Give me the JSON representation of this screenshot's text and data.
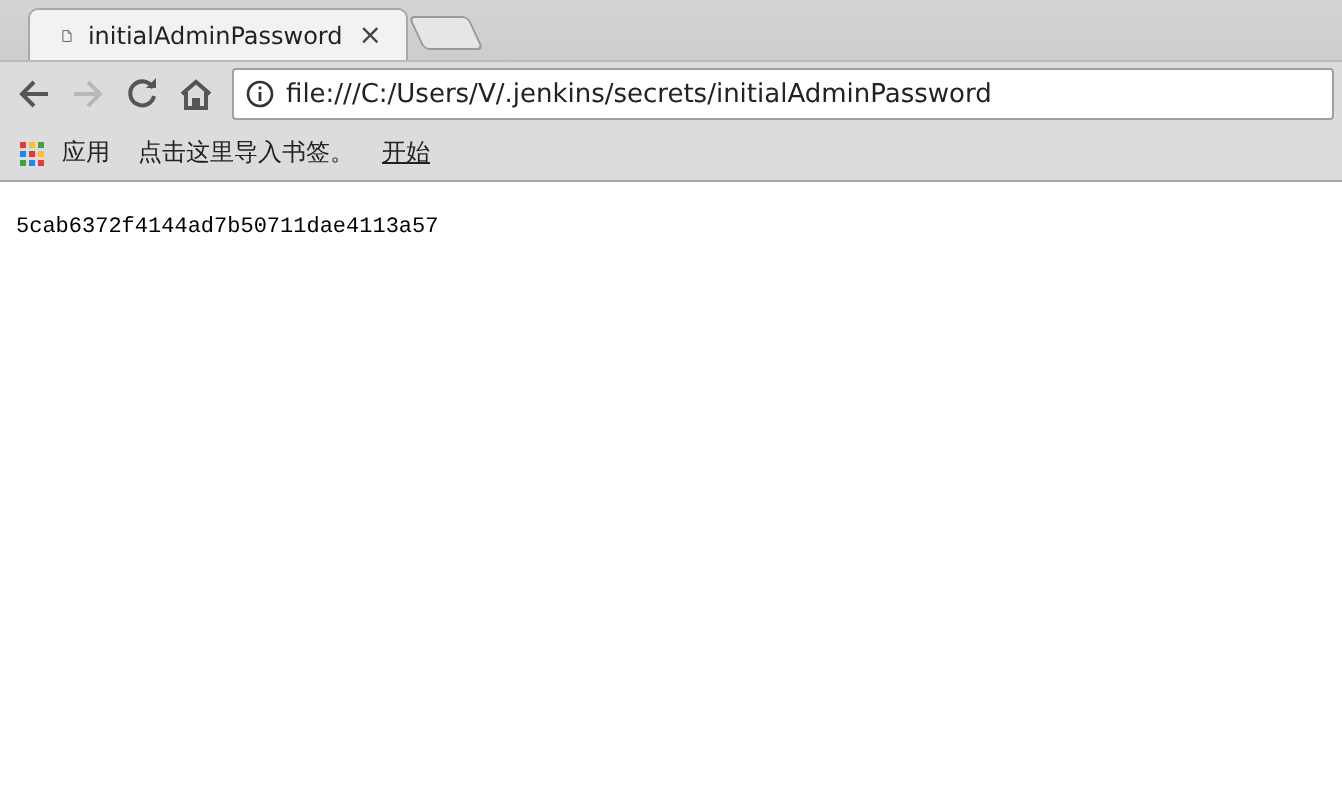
{
  "tabs": [
    {
      "title": "initialAdminPassword",
      "close": "×",
      "selected": true
    }
  ],
  "nav": [
    {
      "kind": "back",
      "disabled": false
    },
    {
      "kind": "forward",
      "disabled": true
    },
    {
      "kind": "reload",
      "disabled": false
    },
    {
      "kind": "home",
      "disabled": false
    }
  ],
  "address": {
    "value": "file:///C:/Users/V/.jenkins/secrets/initialAdminPassword"
  },
  "bookmarks": [
    {
      "kind": "apps",
      "label": "应用"
    },
    {
      "kind": "text",
      "label": "点击这里导入书签。"
    },
    {
      "kind": "link",
      "label": "开始"
    }
  ],
  "content": {
    "text": "5cab6372f4144ad7b50711dae4113a57"
  }
}
